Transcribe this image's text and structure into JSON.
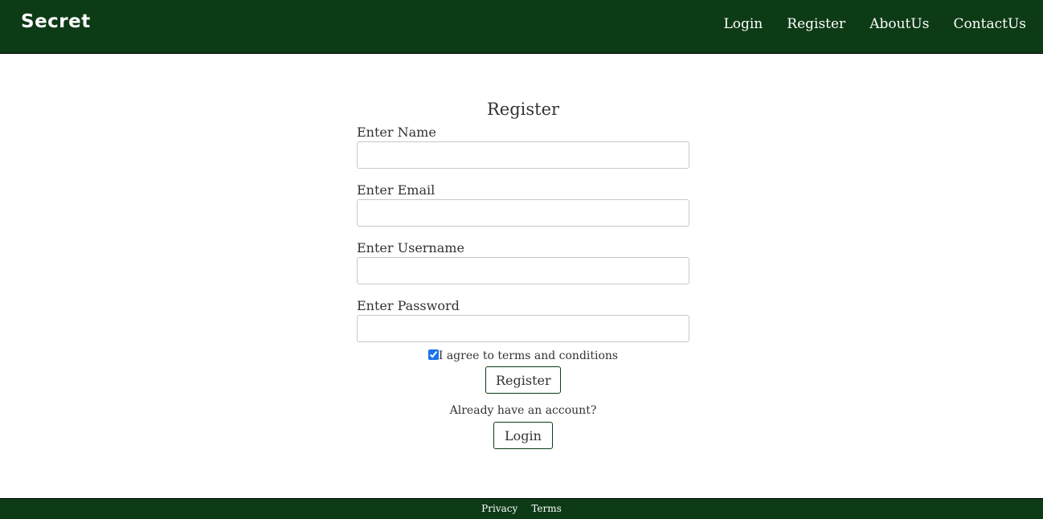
{
  "navbar": {
    "brand": "Secret",
    "links": [
      "Login",
      "Register",
      "AboutUs",
      "ContactUs"
    ]
  },
  "form": {
    "title": "Register",
    "fields": [
      {
        "label": "Enter Name",
        "value": ""
      },
      {
        "label": "Enter Email",
        "value": ""
      },
      {
        "label": "Enter Username",
        "value": ""
      },
      {
        "label": "Enter Password",
        "value": ""
      }
    ],
    "agree_label": "I agree to terms and conditions",
    "agree_checked": true,
    "register_button": "Register",
    "already_text": "Already have an account?",
    "login_button": "Login"
  },
  "footer": {
    "links": [
      "Privacy",
      "Terms"
    ]
  },
  "colors": {
    "brand_green": "#0d3b16",
    "checkbox_accent": "#1a73e8"
  }
}
